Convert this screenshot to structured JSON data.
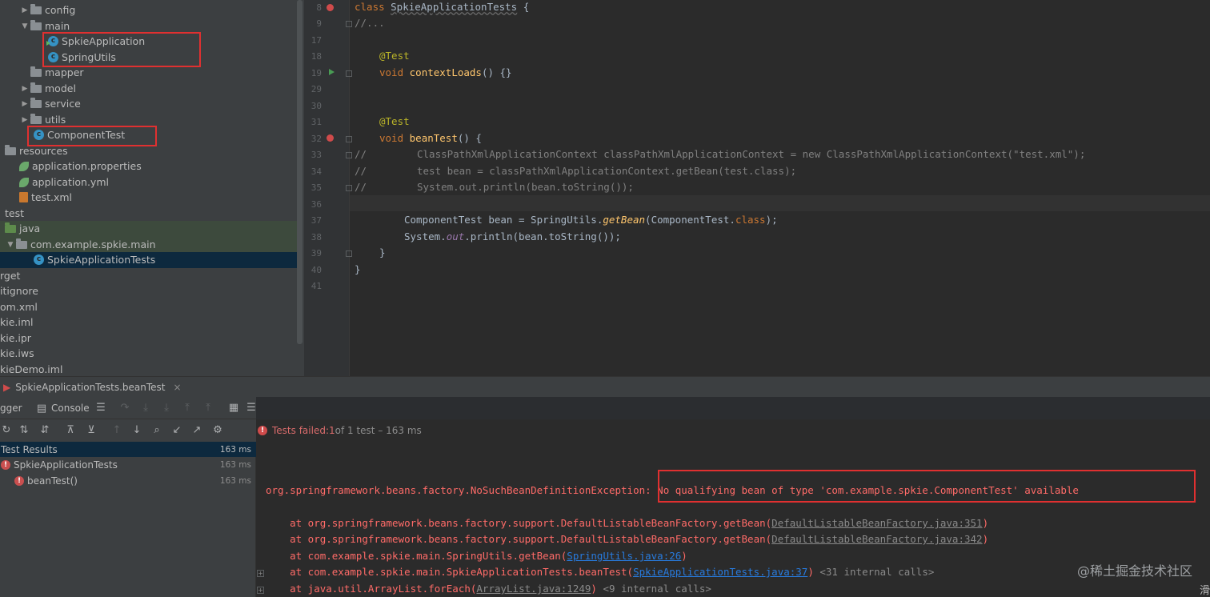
{
  "tree": {
    "items": [
      {
        "label": "config"
      },
      {
        "label": "main"
      },
      {
        "label": "SpkieApplication"
      },
      {
        "label": "SpringUtils"
      },
      {
        "label": "mapper"
      },
      {
        "label": "model"
      },
      {
        "label": "service"
      },
      {
        "label": "utils"
      },
      {
        "label": "ComponentTest"
      },
      {
        "label": "resources"
      },
      {
        "label": "application.properties"
      },
      {
        "label": "application.yml"
      },
      {
        "label": "test.xml"
      },
      {
        "label": "test"
      },
      {
        "label": "java"
      },
      {
        "label": "com.example.spkie.main"
      },
      {
        "label": "SpkieApplicationTests"
      },
      {
        "label": "rget"
      },
      {
        "label": "itignore"
      },
      {
        "label": "om.xml"
      },
      {
        "label": "kie.iml"
      },
      {
        "label": "kie.ipr"
      },
      {
        "label": "kie.iws"
      },
      {
        "label": "kieDemo.iml"
      }
    ]
  },
  "editor": {
    "lines": [
      {
        "no": "8"
      },
      {
        "no": "9"
      },
      {
        "no": "17"
      },
      {
        "no": "18"
      },
      {
        "no": "19"
      },
      {
        "no": "29"
      },
      {
        "no": "30"
      },
      {
        "no": "31"
      },
      {
        "no": "32"
      },
      {
        "no": "33"
      },
      {
        "no": "34"
      },
      {
        "no": "35"
      },
      {
        "no": "36"
      },
      {
        "no": "37"
      },
      {
        "no": "38"
      },
      {
        "no": "39"
      },
      {
        "no": "40"
      },
      {
        "no": "41"
      }
    ],
    "code": {
      "l8_kw": "class ",
      "l8_name": "SpkieApplicationTests",
      "l8_rest": " {",
      "l9": "//...",
      "l18": "@Test",
      "l19_kw": "void ",
      "l19_fn": "contextLoads",
      "l19_rest": "() {}",
      "l31": "@Test",
      "l32_kw": "void ",
      "l32_fn": "beanTest",
      "l32_rest": "() {",
      "l33_slash": "//",
      "l33": "ClassPathXmlApplicationContext classPathXmlApplicationContext = new ClassPathXmlApplicationContext(\"test.xml\");",
      "l34_slash": "//",
      "l34": "test bean = classPathXmlApplicationContext.getBean(test.class);",
      "l35_slash": "//",
      "l35": "System.out.println(bean.toString());",
      "l37_a": "ComponentTest bean = SpringUtils.",
      "l37_b": "getBean",
      "l37_c": "(ComponentTest.",
      "l37_d": "class",
      "l37_e": ");",
      "l38_a": "System.",
      "l38_b": "out",
      "l38_c": ".println(bean.toString());",
      "l39": "}",
      "l40": "}"
    }
  },
  "run": {
    "tab_label": "SpkieApplicationTests.beanTest",
    "debugger_label": "gger",
    "console_label": "Console",
    "status_failed": "Tests failed:",
    "status_count": " 1",
    "status_rest": " of 1 test – 163 ms"
  },
  "results": [
    {
      "label": "Test Results",
      "time": "163 ms"
    },
    {
      "label": "SpkieApplicationTests",
      "time": "163 ms"
    },
    {
      "label": "beanTest()",
      "time": "163 ms"
    }
  ],
  "console": {
    "exception": "org.springframework.beans.factory.NoSuchBeanDefinitionException: No qualifying bean of type 'com.example.spkie.ComponentTest' available",
    "trace": [
      {
        "prefix": "    at org.springframework.beans.factory.support.DefaultListableBeanFactory.getBean(",
        "link": "DefaultListableBeanFactory.java:351",
        "suffix": ")",
        "extra": ""
      },
      {
        "prefix": "    at org.springframework.beans.factory.support.DefaultListableBeanFactory.getBean(",
        "link": "DefaultListableBeanFactory.java:342",
        "suffix": ")",
        "extra": ""
      },
      {
        "prefix": "    at com.example.spkie.main.SpringUtils.getBean(",
        "link": "SpringUtils.java:26",
        "suffix": ")",
        "extra": ""
      },
      {
        "prefix": "    at com.example.spkie.main.SpkieApplicationTests.beanTest(",
        "link": "SpkieApplicationTests.java:37",
        "suffix": ")",
        "extra": " <31 internal calls>"
      },
      {
        "prefix": "    at java.util.ArrayList.forEach(",
        "link": "ArrayList.java:1249",
        "suffix": ")",
        "extra": " <9 internal calls>"
      }
    ]
  },
  "watermark": "@稀土掘金技术社区",
  "corner_glyph": "滑",
  "colors": {
    "error": "#ff6b68",
    "highlight_box": "#e03030",
    "link": "#287bde"
  }
}
